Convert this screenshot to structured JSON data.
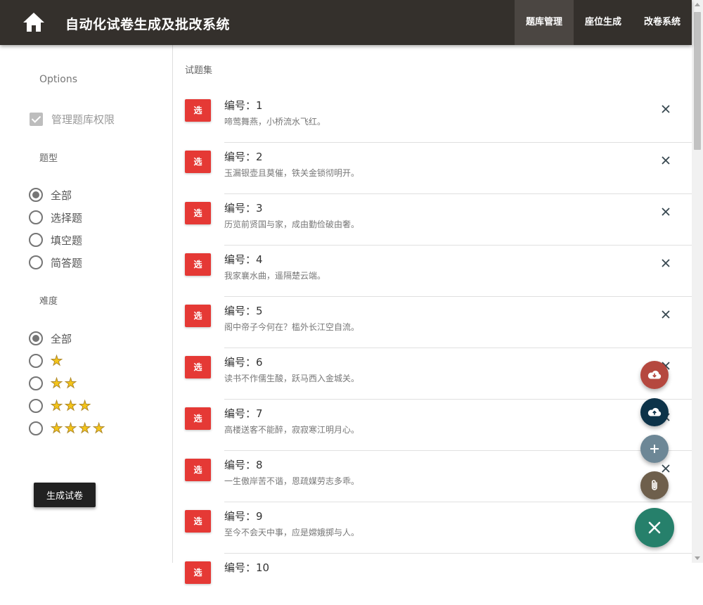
{
  "header": {
    "title": "自动化试卷生成及批改系统",
    "nav": [
      "题库管理",
      "座位生成",
      "改卷系统"
    ],
    "active_nav": "题库管理"
  },
  "sidebar": {
    "options_label": "Options",
    "permission_label": "管理题库权限",
    "permission_checked": true,
    "type_label": "题型",
    "types": [
      "全部",
      "选择题",
      "填空题",
      "简答题"
    ],
    "type_selected": "全部",
    "difficulty_label": "难度",
    "difficulty_all_label": "全部",
    "difficulty_levels": [
      1,
      2,
      3,
      4
    ],
    "difficulty_selected": "全部",
    "generate_button": "生成试卷"
  },
  "main": {
    "section_title": "试题集",
    "select_label": "选",
    "items": [
      {
        "num": "编号：1",
        "text": "啼莺舞燕，小桥流水飞红。"
      },
      {
        "num": "编号：2",
        "text": "玉漏银壶且莫催，铁关金锁彻明开。"
      },
      {
        "num": "编号：3",
        "text": "历览前贤国与家，成由勤俭破由奢。"
      },
      {
        "num": "编号：4",
        "text": "我家襄水曲，遥隔楚云端。"
      },
      {
        "num": "编号：5",
        "text": "阁中帝子今何在？槛外长江空自流。"
      },
      {
        "num": "编号：6",
        "text": "读书不作儒生酸，跃马西入金城关。"
      },
      {
        "num": "编号：7",
        "text": "高楼送客不能醉，寂寂寒江明月心。"
      },
      {
        "num": "编号：8",
        "text": "一生傲岸苦不谐，恩疏媒劳志多乖。"
      },
      {
        "num": "编号：9",
        "text": "至今不会天中事，应是嫦娥掷与人。"
      },
      {
        "num": "编号：10",
        "text": ""
      }
    ]
  },
  "fabs": [
    {
      "icon": "cloud-download-icon",
      "color": "#b5483f"
    },
    {
      "icon": "cloud-upload-icon",
      "color": "#0d3349"
    },
    {
      "icon": "add-icon",
      "color": "#6d8796"
    },
    {
      "icon": "attach-icon",
      "color": "#6e5f4c"
    }
  ],
  "fab_main": {
    "icon": "close-icon",
    "color": "#26806b"
  }
}
